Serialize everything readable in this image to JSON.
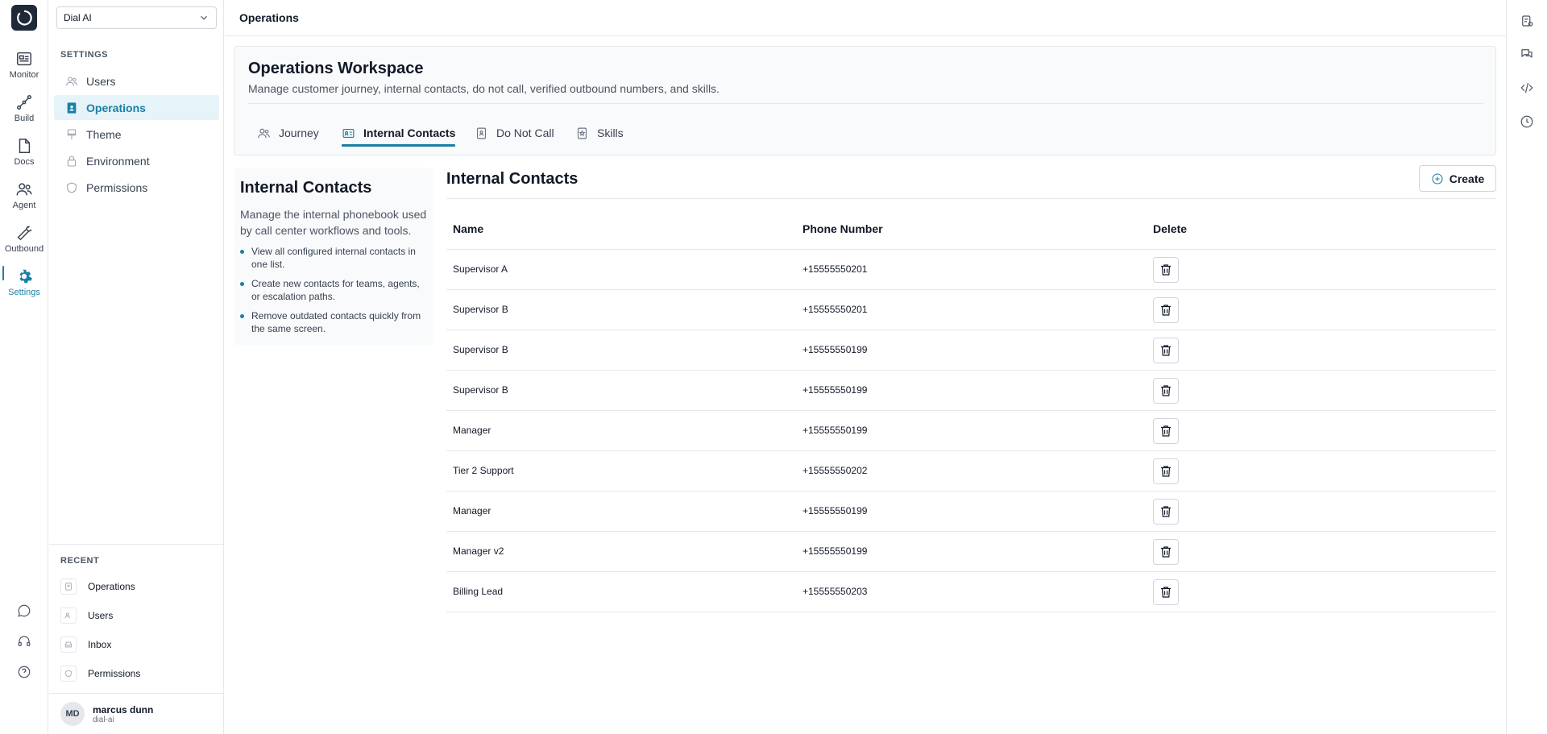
{
  "org_select": {
    "value": "Dial AI"
  },
  "rail": {
    "items": [
      {
        "label": "Monitor"
      },
      {
        "label": "Build"
      },
      {
        "label": "Docs"
      },
      {
        "label": "Agent"
      },
      {
        "label": "Outbound"
      },
      {
        "label": "Settings"
      }
    ]
  },
  "sidebar": {
    "section_label": "SETTINGS",
    "items": [
      {
        "label": "Users"
      },
      {
        "label": "Operations"
      },
      {
        "label": "Theme"
      },
      {
        "label": "Environment"
      },
      {
        "label": "Permissions"
      }
    ],
    "recent_label": "RECENT",
    "recent": [
      {
        "label": "Operations"
      },
      {
        "label": "Users"
      },
      {
        "label": "Inbox"
      },
      {
        "label": "Permissions"
      }
    ]
  },
  "user": {
    "initials": "MD",
    "name": "marcus dunn",
    "org": "dial-ai"
  },
  "topbar": {
    "title": "Operations"
  },
  "workspace": {
    "title": "Operations Workspace",
    "subtitle": "Manage customer journey, internal contacts, do not call, verified outbound numbers, and skills.",
    "tabs": [
      {
        "label": "Journey"
      },
      {
        "label": "Internal Contacts"
      },
      {
        "label": "Do Not Call"
      },
      {
        "label": "Skills"
      }
    ],
    "active_tab": "Internal Contacts"
  },
  "info": {
    "title": "Internal Contacts",
    "description": "Manage the internal phonebook used by call center workflows and tools.",
    "bullets": [
      "View all configured internal contacts in one list.",
      "Create new contacts for teams, agents, or escalation paths.",
      "Remove outdated contacts quickly from the same screen."
    ]
  },
  "contacts": {
    "title": "Internal Contacts",
    "create_label": "Create",
    "columns": [
      "Name",
      "Phone Number",
      "Delete"
    ],
    "rows": [
      {
        "name": "Supervisor A",
        "phone": "+15555550201"
      },
      {
        "name": "Supervisor B",
        "phone": "+15555550201"
      },
      {
        "name": "Supervisor B",
        "phone": "+15555550199"
      },
      {
        "name": "Supervisor B",
        "phone": "+15555550199"
      },
      {
        "name": "Manager",
        "phone": "+15555550199"
      },
      {
        "name": "Tier 2 Support",
        "phone": "+15555550202"
      },
      {
        "name": "Manager",
        "phone": "+15555550199"
      },
      {
        "name": "Manager v2",
        "phone": "+15555550199"
      },
      {
        "name": "Billing Lead",
        "phone": "+15555550203"
      }
    ]
  },
  "colors": {
    "accent": "#1a7fa6",
    "border": "#e5e7eb",
    "logo_bg": "#1f2937"
  }
}
